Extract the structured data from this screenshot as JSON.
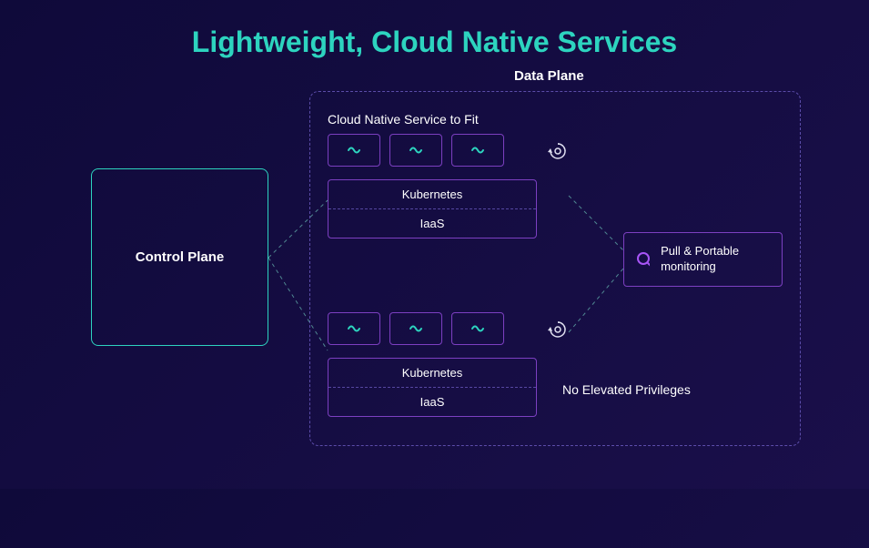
{
  "title": "Lightweight, Cloud Native Services",
  "control_plane": {
    "label": "Control Plane"
  },
  "data_plane": {
    "label": "Data Plane",
    "section_title": "Cloud Native Service to Fit",
    "cluster1": {
      "layer1": "Kubernetes",
      "layer2": "IaaS"
    },
    "cluster2": {
      "layer1": "Kubernetes",
      "layer2": "IaaS"
    },
    "monitoring": "Pull & Portable monitoring",
    "privileges": "No Elevated Privileges"
  },
  "icons": {
    "wave": "wave-icon",
    "sync": "sync-icon",
    "search": "search-icon"
  },
  "colors": {
    "accent_teal": "#2dd4bf",
    "accent_purple": "#a855f7",
    "bg_start": "#0f0a3a",
    "bg_end": "#1a0f4a"
  }
}
